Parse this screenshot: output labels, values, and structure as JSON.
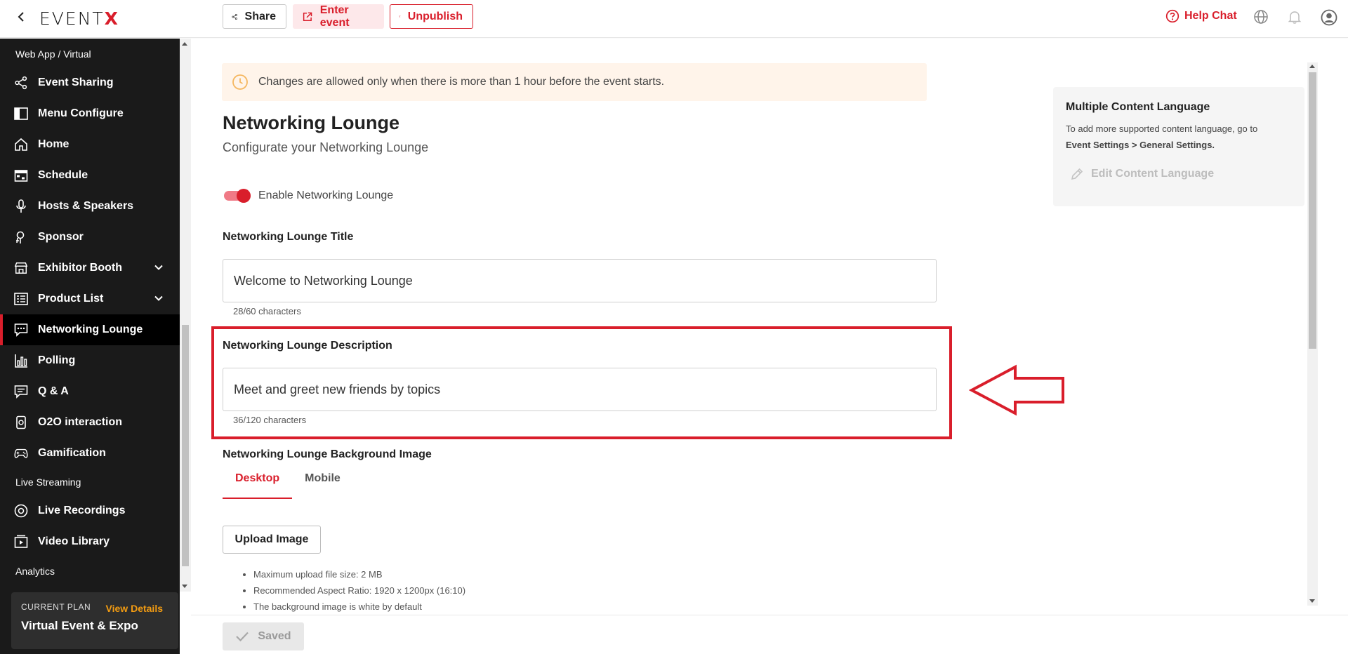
{
  "brand": {
    "logo_text": "EVENT",
    "logo_x": "X",
    "accent": "#d91e2b",
    "orange": "#f39c12"
  },
  "toolbar": {
    "share_label": "Share",
    "enter_label": "Enter event",
    "unpublish_label": "Unpublish",
    "help_chat_label": "Help Chat"
  },
  "sidebar": {
    "section_web_app": "Web App / Virtual",
    "items": [
      {
        "label": "Event Sharing",
        "icon": "share-icon"
      },
      {
        "label": "Menu Configure",
        "icon": "layout-icon"
      },
      {
        "label": "Home",
        "icon": "home-icon"
      },
      {
        "label": "Schedule",
        "icon": "calendar-icon"
      },
      {
        "label": "Hosts & Speakers",
        "icon": "microphone-icon"
      },
      {
        "label": "Sponsor",
        "icon": "sponsor-icon"
      },
      {
        "label": "Exhibitor Booth",
        "icon": "store-icon"
      },
      {
        "label": "Product List",
        "icon": "list-icon"
      },
      {
        "label": "Networking Lounge",
        "icon": "chat-icon"
      },
      {
        "label": "Polling",
        "icon": "bar-chart-icon"
      },
      {
        "label": "Q & A",
        "icon": "qa-icon"
      },
      {
        "label": "O2O interaction",
        "icon": "phone-icon"
      },
      {
        "label": "Gamification",
        "icon": "gamepad-icon"
      }
    ],
    "section_live": "Live Streaming",
    "live_items": [
      {
        "label": "Live Recordings",
        "icon": "record-icon"
      },
      {
        "label": "Video Library",
        "icon": "video-icon"
      }
    ],
    "section_analytics": "Analytics",
    "plan": {
      "label": "CURRENT PLAN",
      "link": "View Details",
      "name": "Virtual Event & Expo"
    }
  },
  "main": {
    "notice": "Changes are allowed only when there is more than 1 hour before the event starts.",
    "title": "Networking Lounge",
    "subtitle": "Configurate your Networking Lounge",
    "toggle_label": "Enable Networking Lounge",
    "toggle_on": true,
    "title_field": {
      "label": "Networking Lounge Title",
      "value": "Welcome to Networking Lounge",
      "count": "28/60 characters"
    },
    "desc_field": {
      "label": "Networking Lounge Description",
      "value": "Meet and greet new friends by topics",
      "count": "36/120 characters"
    },
    "bg_label": "Networking Lounge Background Image",
    "tabs": [
      "Desktop",
      "Mobile"
    ],
    "upload_label": "Upload Image",
    "bullets": [
      "Maximum upload file size: 2 MB",
      "Recommended Aspect Ratio: 1920 x 1200px (16:10)",
      "The background image is white by default"
    ],
    "saved_label": "Saved"
  },
  "language_card": {
    "title": "Multiple Content Language",
    "desc": "To add more supported content language, go to",
    "path": "Event Settings > General Settings.",
    "edit_label": "Edit Content Language"
  }
}
